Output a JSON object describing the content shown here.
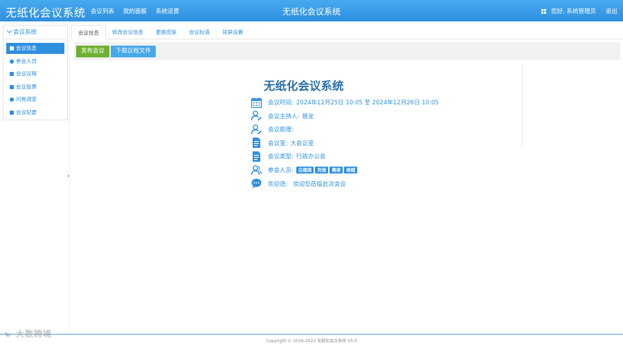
{
  "header": {
    "brand": "无纸化会议系统",
    "nav": [
      "会议列表",
      "我的面板",
      "系统设置"
    ],
    "center_title": "无纸化会议系统",
    "greeting": "您好, 系统管理员",
    "logout": "退出"
  },
  "sidebar": {
    "title": "会议系统",
    "items": [
      {
        "label": "会议信息",
        "icon": "list-icon",
        "active": true
      },
      {
        "label": "参会人员",
        "icon": "user-icon",
        "active": false
      },
      {
        "label": "会议议程",
        "icon": "agenda-icon",
        "active": false
      },
      {
        "label": "会议投票",
        "icon": "vote-icon",
        "active": false
      },
      {
        "label": "问卷调查",
        "icon": "comment-icon",
        "active": false
      },
      {
        "label": "会议纪要",
        "icon": "file-icon",
        "active": false
      }
    ]
  },
  "tabs": [
    "会议信息",
    "修改会议信息",
    "更换皮肤",
    "会议标语",
    "背屏设置"
  ],
  "toolbar": {
    "publish": "发布会议",
    "download": "下载议程文件"
  },
  "meeting": {
    "title": "无纸化会议系统",
    "time_label": "会议时间:",
    "time_value": "2024年12月25日 10:05 至 2024年12月26日 10:05",
    "host_label": "会议主持人:",
    "host_value": "聂龙",
    "assistant_label": "会议助理:",
    "assistant_value": "",
    "room_label": "会议室:",
    "room_value": "大会议室",
    "type_label": "会议类型:",
    "type_value": "行政办公会",
    "attendees_label": "参会人员:",
    "attendees": [
      "白建南",
      "刘佳",
      "蔺弟",
      "杨程"
    ],
    "welcome_label": "欢迎语:",
    "welcome_value": "欢迎您莅临此次会议"
  },
  "footer": {
    "copyright": "Copyright © 2016-2022 无纸化会议系统 V5.0"
  },
  "watermark": "大数跨境",
  "colors": {
    "primary": "#2e8fdf",
    "header_top": "#47aaf0",
    "green_button": "#6fb033",
    "blue_button": "#45a9ea",
    "title": "#2a70a8"
  }
}
